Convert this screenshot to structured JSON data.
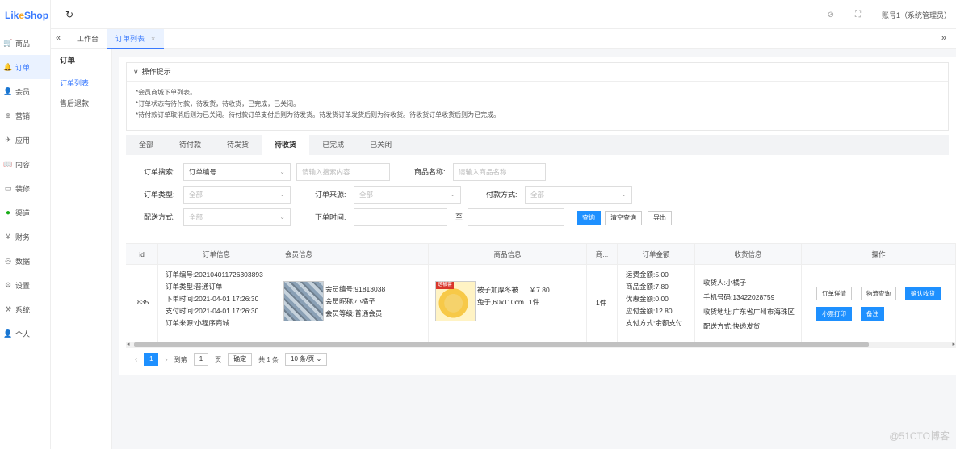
{
  "app": {
    "logo_prefix": "Lik",
    "logo_o": "e",
    "logo_suffix": "Shop"
  },
  "sidebar": {
    "items": [
      {
        "icon": "🛒",
        "label": "商品"
      },
      {
        "icon": "🔔",
        "label": "订单"
      },
      {
        "icon": "👤",
        "label": "会员"
      },
      {
        "icon": "⊕",
        "label": "营销"
      },
      {
        "icon": "✈",
        "label": "应用"
      },
      {
        "icon": "📖",
        "label": "内容"
      },
      {
        "icon": "▭",
        "label": "装修"
      },
      {
        "icon": "●",
        "label": "渠道"
      },
      {
        "icon": "¥",
        "label": "财务"
      },
      {
        "icon": "◎",
        "label": "数据"
      },
      {
        "icon": "⚙",
        "label": "设置"
      },
      {
        "icon": "⚒",
        "label": "系统"
      },
      {
        "icon": "👤",
        "label": "个人"
      }
    ]
  },
  "subnav": {
    "title": "订单",
    "items": [
      "订单列表",
      "售后退款"
    ]
  },
  "header": {
    "refresh_icon": "↻",
    "tag_icon": "⊘",
    "fullscreen_icon": "⛶",
    "account": "账号1（系统管理员）"
  },
  "tabbar": {
    "back": "«",
    "forward": "»",
    "tabs": [
      {
        "label": "工作台"
      },
      {
        "label": "订单列表",
        "close": "×"
      }
    ]
  },
  "tip": {
    "title": "操作提示",
    "chevron": "∨",
    "lines": [
      "*会员商城下单列表。",
      "*订单状态有待付款，待发货，待收货，已完成，已关闭。",
      "*待付款订单取消后则为已关闭。待付款订单支付后则为待发货。待发货订单发货后则为待收货。待收货订单收货后则为已完成。"
    ]
  },
  "status_tabs": [
    {
      "label": "全部",
      "active": false
    },
    {
      "label": "待付款",
      "active": false
    },
    {
      "label": "待发货",
      "active": false
    },
    {
      "label": "待收货",
      "active": true
    },
    {
      "label": "已完成",
      "active": false
    },
    {
      "label": "已关闭",
      "active": false
    }
  ],
  "filters": {
    "order_search_label": "订单搜索:",
    "order_search_field": "订单编号",
    "search_placeholder": "请输入搜索内容",
    "goods_name_label": "商品名称:",
    "goods_name_placeholder": "请输入商品名称",
    "order_type_label": "订单类型:",
    "order_type_value": "全部",
    "order_source_label": "订单来源:",
    "order_source_value": "全部",
    "pay_method_label": "付款方式:",
    "pay_method_value": "全部",
    "delivery_label": "配送方式:",
    "delivery_value": "全部",
    "order_time_label": "下单时间:",
    "to": "至",
    "query_btn": "查询",
    "clear_btn": "清空查询",
    "export_btn": "导出",
    "arrow": "⌄"
  },
  "table": {
    "headers": [
      "id",
      "订单信息",
      "会员信息",
      "商品信息",
      "商...",
      "订单金额",
      "收货信息",
      "操作"
    ],
    "row": {
      "id": "835",
      "order": [
        "订单编号:202104011726303893",
        "订单类型:普通订单",
        "下单时间:2021-04-01 17:26:30",
        "支付时间:2021-04-01 17:26:30",
        "订单来源:小程序商城"
      ],
      "member": [
        "会员编号:91813038",
        "会员昵称:小橘子",
        "会员等级:普通会员"
      ],
      "goods": {
        "name_line1": "被子加厚冬被...",
        "price": "¥ 7.80",
        "name_line2": "兔子,60x110cm",
        "qty": "1件",
        "tag": "送被套"
      },
      "qty": "1件",
      "amount": [
        "运费金额:5.00",
        "商品金额:7.80",
        "优惠金额:0.00",
        "应付金额:12.80",
        "支付方式:余额支付"
      ],
      "receiver": [
        "收货人:小橘子",
        "手机号码:13422028759",
        "收货地址:广东省广州市海珠区",
        "配送方式:快递发货"
      ],
      "ops": {
        "detail": "订单详情",
        "logistics": "物流查询",
        "confirm": "确认收货",
        "print": "小票打印",
        "remark": "备注"
      }
    }
  },
  "scroll": {
    "left": "◂",
    "right": "▸"
  },
  "pager": {
    "prev": "‹",
    "page": "1",
    "next": "›",
    "goto": "到第",
    "page_input": "1",
    "page_unit": "页",
    "confirm": "确定",
    "total": "共 1 条",
    "per_page": "10 条/页 ⌄"
  },
  "watermark": "@51CTO博客"
}
